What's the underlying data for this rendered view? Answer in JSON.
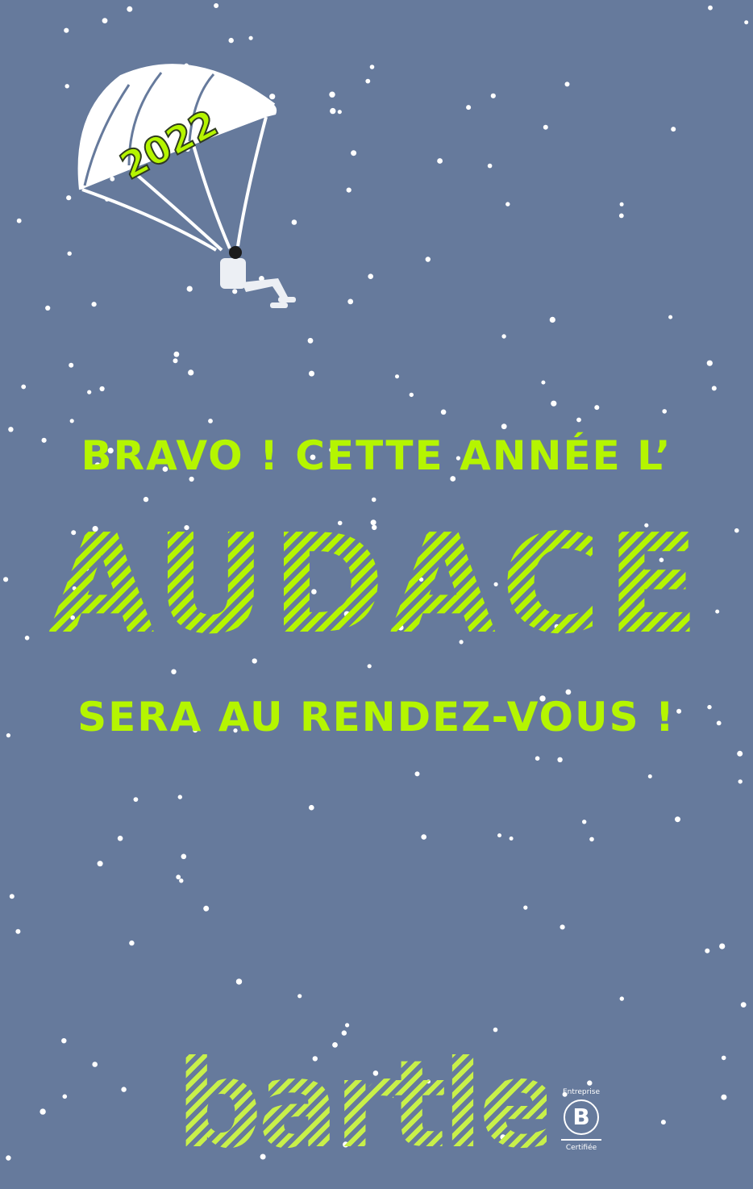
{
  "colors": {
    "background": "#667a9c",
    "accent": "#b5f500",
    "snow": "#ffffff"
  },
  "parachute": {
    "year": "2022",
    "icon": "parachutist-icon"
  },
  "message": {
    "line1": "BRAVO ! CETTE ANNÉE L’",
    "highlight": "AUDACE",
    "line3": "SERA AU RENDEZ-VOUS !"
  },
  "brand": {
    "name": "bartle"
  },
  "certification": {
    "top": "Entreprise",
    "letter": "B",
    "bottom": "Certifiée"
  }
}
